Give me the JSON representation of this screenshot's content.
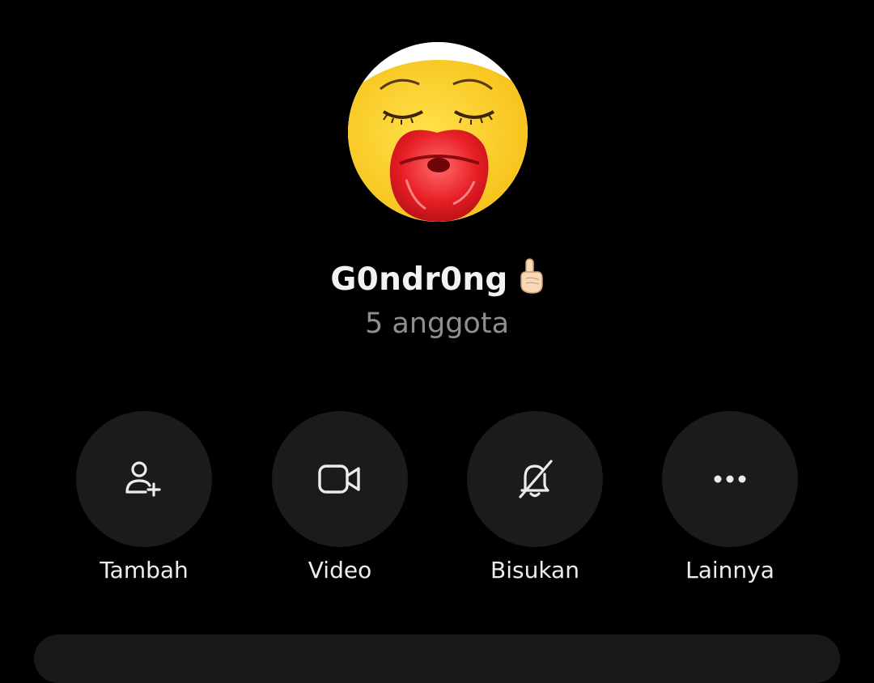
{
  "group": {
    "name": "G0ndr0ng",
    "name_emoji": "☝️",
    "member_count_text": "5 anggota"
  },
  "avatar": {
    "description_icon": "kissing-lips-emoji-avatar"
  },
  "actions": [
    {
      "label": "Tambah",
      "icon": "add-person-icon"
    },
    {
      "label": "Video",
      "icon": "video-camera-icon"
    },
    {
      "label": "Bisukan",
      "icon": "bell-off-icon"
    },
    {
      "label": "Lainnya",
      "icon": "more-horizontal-icon"
    }
  ],
  "colors": {
    "background": "#000000",
    "button_bg": "#1a1b1d",
    "primary_text": "#f2f2f2",
    "secondary_text": "#8d8f94"
  }
}
